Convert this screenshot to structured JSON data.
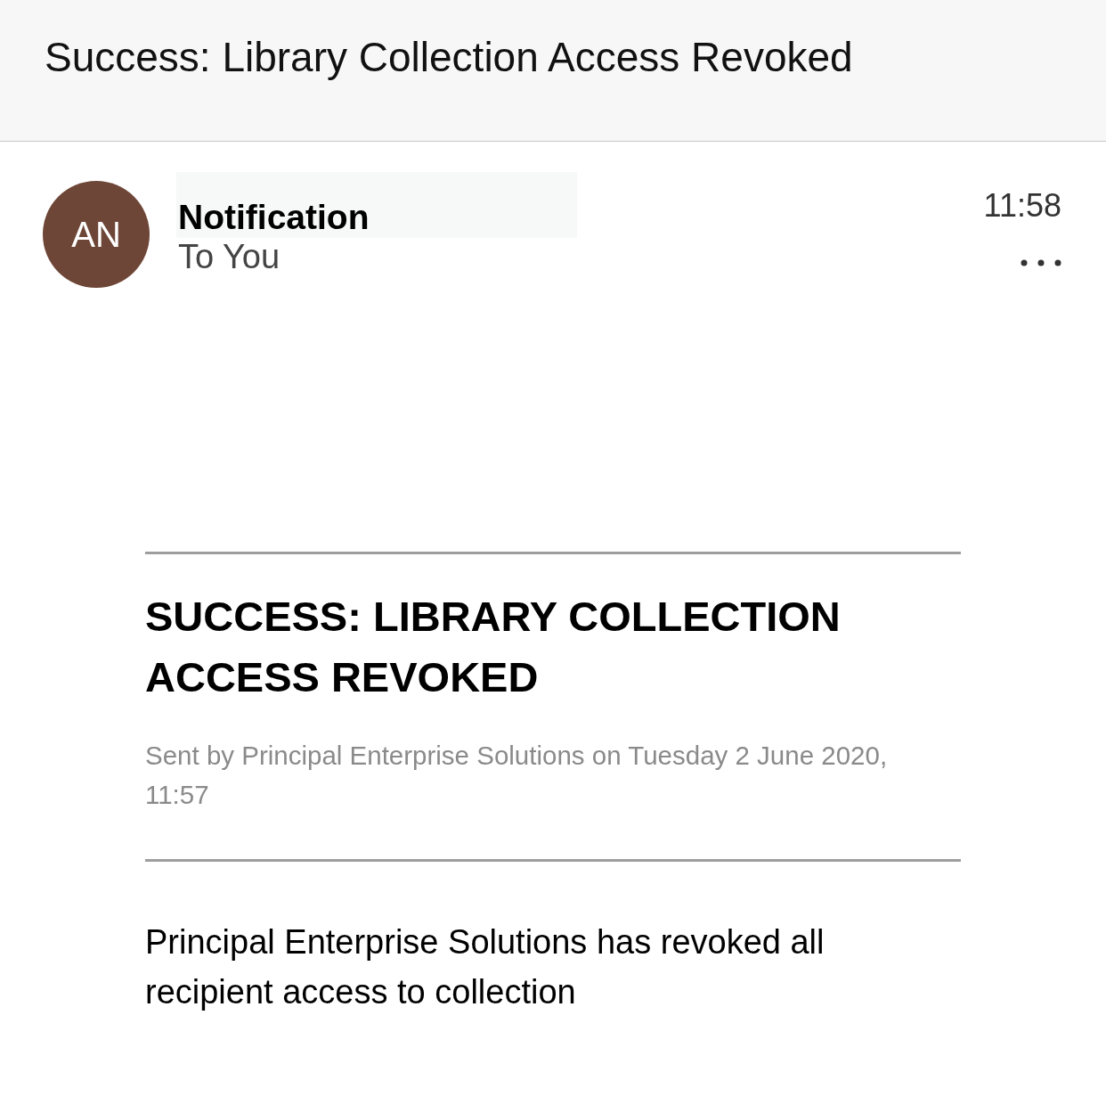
{
  "header": {
    "title": "Success: Library Collection Access Revoked"
  },
  "message": {
    "avatar_initials": "AN",
    "sender": "Notification",
    "recipient": "To You",
    "time": "11:58"
  },
  "body": {
    "heading": "SUCCESS: LIBRARY COLLECTION ACCESS REVOKED",
    "sent_by": "Sent by Principal Enterprise Solutions on Tuesday 2 June 2020, 11:57",
    "text": "Principal Enterprise Solutions has revoked all recipient access to collection"
  }
}
